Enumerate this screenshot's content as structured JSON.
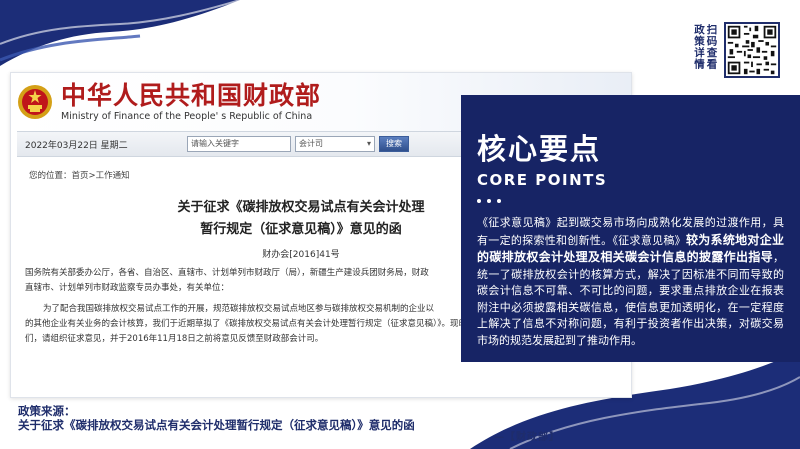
{
  "qr": {
    "label_col1": "扫码查看",
    "label_col2": "政策详情"
  },
  "site": {
    "title_cn": "中华人民共和国财政部",
    "title_en": "Ministry of Finance of the People' s Republic of China"
  },
  "nav": {
    "date": "2022年03月22日 星期二",
    "search_placeholder": "请输入关键字",
    "select_value": "会计司",
    "search_button": "搜索"
  },
  "breadcrumb": "您的位置：首页>工作通知",
  "document": {
    "title_line1": "关于征求《碳排放权交易试点有关会计处理",
    "title_line2": "暂行规定（征求意见稿）》意见的函",
    "number": "财办会[2016]41号",
    "paragraph1_line1": "国务院有关部委办公厅，各省、自治区、直辖市、计划单列市财政厅（局），新疆生产建设兵团财务局，财政",
    "paragraph1_line2": "直辖市、计划单列市财政监察专员办事处，有关单位：",
    "paragraph2_line1": "为了配合我国碳排放权交易试点工作的开展，规范碳排放权交易试点地区参与碳排放权交易机制的企业以",
    "paragraph2_line2": "的其他企业有关业务的会计核算，我们于近期草拟了《碳排放权交易试点有关会计处理暂行规定（征求意见稿）》。现印发给你",
    "paragraph2_line3": "们，请组织征求意见，并于2016年11月18日之前将意见反馈至财政部会计司。"
  },
  "source": {
    "label": "政策来源：",
    "text": "关于征求《碳排放权交易试点有关会计处理暂行规定（征求意见稿）》意见的函"
  },
  "panel": {
    "title": "核心要点",
    "subtitle": "CORE POINTS",
    "text_part1": "《征求意见稿》起到碳交易市场向成熟化发展的过渡作用，具有一定的探索性和创新性。《征求意见稿》",
    "text_bold": "较为系统地对企业的碳排放权会计处理及相关碳会计信息的披露作出指导",
    "text_part2": "，统一了碳排放权会计的核算方式，解决了因标准不同而导致的碳会计信息不可靠、不可比的问题，要求重点排放企业在报表附注中必须披露相关碳信息，使信息更加透明化，在一定程度上解决了信息不对称问题，有利于投资者作出决策，对碳交易市场的规范发展起到了推动作用。"
  },
  "credit": "—【财政部】"
}
